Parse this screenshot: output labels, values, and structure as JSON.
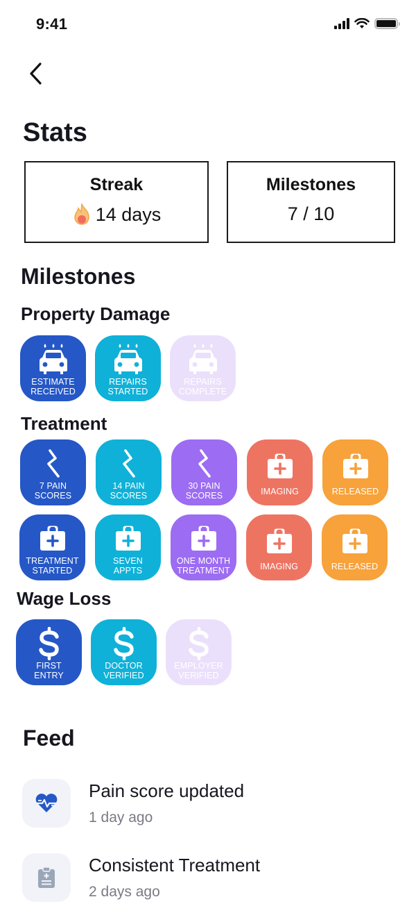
{
  "status_bar": {
    "time": "9:41",
    "icons": [
      "signal-icon",
      "wifi-icon",
      "battery-icon"
    ]
  },
  "nav": {
    "back_icon": "chevron-left-icon"
  },
  "stats": {
    "title": "Stats",
    "streak": {
      "label": "Streak",
      "icon": "fire-icon",
      "value": "14 days"
    },
    "milestones": {
      "label": "Milestones",
      "value": "7 / 10"
    }
  },
  "milestones": {
    "title": "Milestones",
    "groups": [
      {
        "title": "Property Damage",
        "badges": [
          {
            "label": "ESTIMATE\nRECEIVED",
            "icon": "car-icon",
            "color": "#2557c6",
            "earned": true
          },
          {
            "label": "REPAIRS\nSTARTED",
            "icon": "car-icon",
            "color": "#0fb1d8",
            "earned": true
          },
          {
            "label": "REPAIRS\nCOMPLETE",
            "icon": "car-icon",
            "color": "#ebe0fb",
            "earned": false
          }
        ]
      },
      {
        "title": "Treatment",
        "rows": [
          [
            {
              "label": "7 PAIN\nSCORES",
              "icon": "lightning-icon",
              "color": "#2557c6",
              "earned": true
            },
            {
              "label": "14 PAIN\nSCORES",
              "icon": "lightning-icon",
              "color": "#0fb1d8",
              "earned": true
            },
            {
              "label": "30 PAIN\nSCORES",
              "icon": "lightning-icon",
              "color": "#9c6cf2",
              "earned": true
            },
            {
              "label": "IMAGING",
              "icon": "medkit-icon",
              "color": "#ee7462",
              "earned": true
            },
            {
              "label": "RELEASED",
              "icon": "medkit-icon",
              "color": "#f7a23a",
              "earned": true
            }
          ],
          [
            {
              "label": "TREATMENT\nSTARTED",
              "icon": "medkit-icon",
              "color": "#2557c6",
              "earned": true
            },
            {
              "label": "SEVEN\nAPPTS",
              "icon": "medkit-icon",
              "color": "#0fb1d8",
              "earned": true
            },
            {
              "label": "ONE MONTH\nTREATMENT",
              "icon": "medkit-icon",
              "color": "#9c6cf2",
              "earned": true
            },
            {
              "label": "IMAGING",
              "icon": "medkit-icon",
              "color": "#ee7462",
              "earned": true
            },
            {
              "label": "RELEASED",
              "icon": "medkit-icon",
              "color": "#f7a23a",
              "earned": true
            }
          ]
        ]
      },
      {
        "title": "Wage Loss",
        "badges": [
          {
            "label": "FIRST\nENTRY",
            "icon": "dollar-icon",
            "color": "#2557c6",
            "earned": true
          },
          {
            "label": "DOCTOR\nVERIFIED",
            "icon": "dollar-icon",
            "color": "#0fb1d8",
            "earned": true
          },
          {
            "label": "EMPLOYER\nVERIFIED",
            "icon": "dollar-icon",
            "color": "#ebe0fb",
            "earned": false
          }
        ]
      }
    ]
  },
  "feed": {
    "title": "Feed",
    "items": [
      {
        "title": "Pain score updated",
        "time": "1 day ago",
        "icon": "heartbeat-icon",
        "icon_color": "#2557c6"
      },
      {
        "title": "Consistent Treatment",
        "time": "2 days ago",
        "icon": "clipboard-medical-icon",
        "icon_color": "#9aa6b8"
      }
    ]
  }
}
